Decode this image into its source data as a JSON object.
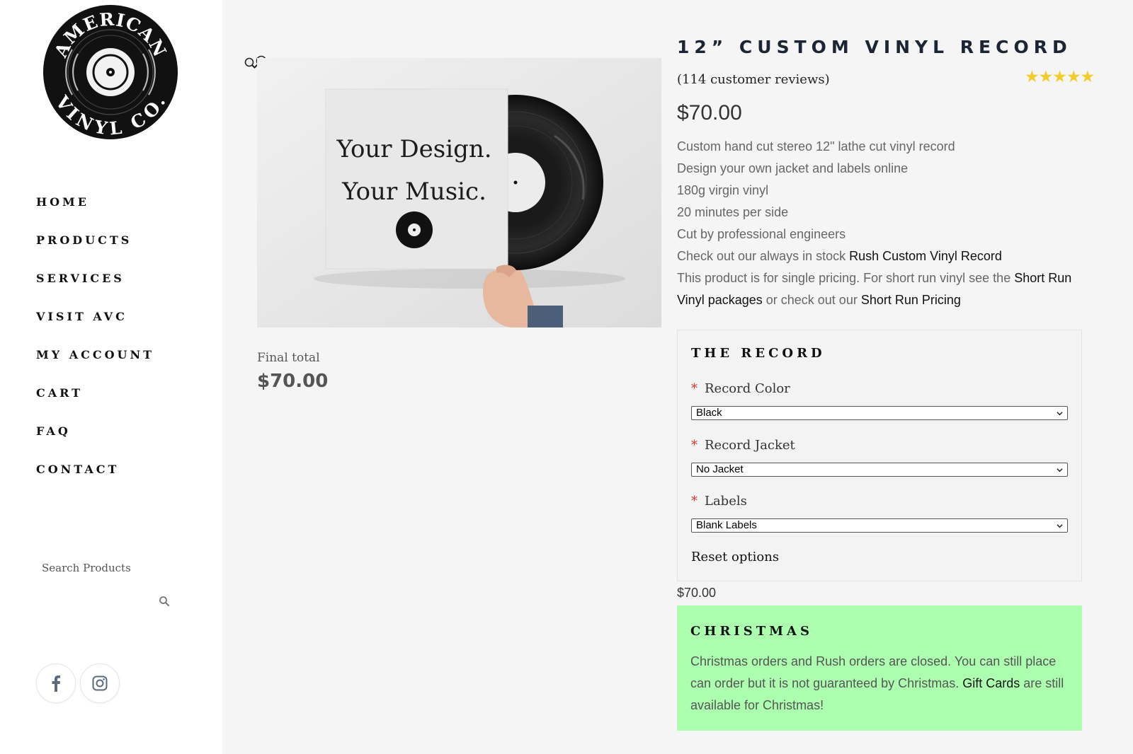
{
  "brand": {
    "logo_text_top": "AMERICAN",
    "logo_text_bottom": "VINYL CO."
  },
  "nav": {
    "items": [
      {
        "label": "HOME"
      },
      {
        "label": "PRODUCTS"
      },
      {
        "label": "SERVICES"
      },
      {
        "label": "VISIT AVC"
      },
      {
        "label": "MY ACCOUNT"
      },
      {
        "label": "CART"
      },
      {
        "label": "FAQ"
      },
      {
        "label": "CONTACT"
      }
    ]
  },
  "search": {
    "placeholder": "Search Products",
    "icon": "search-icon"
  },
  "social": [
    {
      "icon": "facebook-icon"
    },
    {
      "icon": "instagram-icon"
    }
  ],
  "gallery": {
    "zoom_icon": "zoom-icon",
    "image_text_line1": "Your Design.",
    "image_text_line2": "Your Music.",
    "final_total_label": "Final total",
    "final_total_value": "$70.00"
  },
  "product": {
    "title": "12” CUSTOM VINYL RECORD",
    "reviews": "(114 customer reviews)",
    "rating": 5,
    "stars_display": "★★★★★",
    "price": "$70.00",
    "description": {
      "line1": "Custom hand cut stereo 12\" lathe cut vinyl record",
      "line2": "Design your own jacket and labels online",
      "line3": "180g virgin vinyl",
      "line4": "20 minutes per side",
      "line5": "Cut by professional engineers",
      "line6_prefix": "Check out our always in stock ",
      "line6_link": "Rush Custom Vinyl Record",
      "line7_prefix": "This product is for single pricing. For short run vinyl see the ",
      "line7_link1": "Short Run Vinyl packages",
      "line7_mid": " or check out our ",
      "line7_link2": "Short Run Pricing"
    }
  },
  "options": {
    "title": "THE RECORD",
    "required_marker": "*",
    "record_color": {
      "label": "Record Color",
      "value": "Black"
    },
    "record_jacket": {
      "label": "Record Jacket",
      "value": "No Jacket"
    },
    "labels": {
      "label": "Labels",
      "value": "Blank Labels"
    },
    "reset": "Reset options"
  },
  "variation_price": "$70.00",
  "notice": {
    "title": "CHRISTMAS",
    "text_prefix": "Christmas orders and Rush orders are closed. You can still place can order but it is not guaranteed by Christmas. ",
    "link": "Gift Cards",
    "text_suffix": " are still available for Christmas!",
    "background": "#adffb0"
  },
  "colors": {
    "star": "#f3cb2b",
    "required": "#dd3333",
    "title": "#1c2533"
  }
}
